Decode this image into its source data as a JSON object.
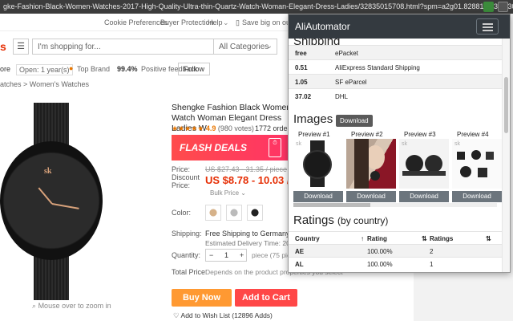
{
  "browser": {
    "url": "gke-Fashion-Black-Women-Watches-2017-High-Quality-Ultra-thin-Quartz-Watch-Woman-Elegant-Dress-Ladies/32835015708.html?spm=a2g01.8288187.3.1630525c4mnv8g&"
  },
  "topnav": {
    "cookie": "Cookie Preferences",
    "buyer": "Buyer Protection",
    "help": "Help",
    "app": "Save big on our app"
  },
  "search": {
    "logo": "s",
    "placeholder": "I'm shopping for...",
    "category": "All Categories"
  },
  "store": {
    "label": "ore",
    "open": "Open: 1 year(s)",
    "top_brand": "Top Brand",
    "pct": "99.4%",
    "feedback": "Positive feedback",
    "follow": "Follow"
  },
  "breadcrumb": "atches > Women's Watches",
  "product": {
    "title": "Shengke Fashion Black Women Watch Woman Elegant Dress Ladies W",
    "stars": "★★★★★",
    "score": "4.9",
    "votes": "(980 votes)",
    "orders": "1772 orders",
    "flash": "FLASH DEALS",
    "price_label": "Price:",
    "old_price": "US $27.43 - 31.35 / piece",
    "discount_label": "Discount Price:",
    "new_price": "US $8.78 - 10.03 / pi",
    "bulk": "Bulk Price",
    "color_label": "Color:",
    "shipping_label": "Shipping:",
    "shipping_text": "Free Shipping to Germany via e",
    "shipping_time": "Estimated Delivery Time: 20-40",
    "qty_label": "Quantity:",
    "qty_minus": "−",
    "qty_value": "1",
    "qty_plus": "+",
    "qty_note": "piece (75 pieces available)",
    "total_label": "Total Price:",
    "total_note": "Depends on the product properties you select",
    "buy_now": "Buy Now",
    "add_cart": "Add to Cart",
    "wish": "Add to Wish List (12896 Adds)",
    "zoom_hint": "Mouse over to zoom in",
    "watch_logo": "sk"
  },
  "panel": {
    "title": "AliAutomator",
    "partial_heading": "Shipping",
    "shipping_rows": [
      {
        "price": "free",
        "method": "ePacket"
      },
      {
        "price": "0.51",
        "method": "AliExpress Standard Shipping"
      },
      {
        "price": "1.05",
        "method": "SF eParcel"
      },
      {
        "price": "37.02",
        "method": "DHL"
      }
    ],
    "images_heading": "Images",
    "download_all": "Download",
    "previews": [
      {
        "label": "Preview #1",
        "btn": "Download",
        "badge": "sk"
      },
      {
        "label": "Preview #2",
        "btn": "Download",
        "badge": ""
      },
      {
        "label": "Preview #3",
        "btn": "Download",
        "badge": "sk"
      },
      {
        "label": "Preview #4",
        "btn": "Download",
        "badge": "sk"
      }
    ],
    "ratings_heading": "Ratings",
    "ratings_sub": "(by country)",
    "ratings_cols": [
      "Country",
      "Rating",
      "Ratings"
    ],
    "ratings_rows": [
      {
        "country": "AE",
        "rating": "100.00%",
        "count": "2"
      },
      {
        "country": "AL",
        "rating": "100.00%",
        "count": "1"
      }
    ]
  },
  "colors": {
    "accent": "#e62e04",
    "flash": "#ff4c4c",
    "buy": "#ff9932",
    "cart": "#ff4747",
    "panel_head": "#343a40",
    "button_gray": "#6c757d"
  }
}
